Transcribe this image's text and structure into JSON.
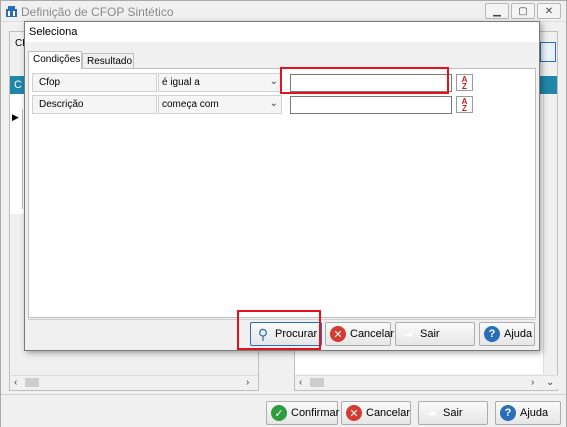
{
  "window": {
    "title": "Definição de CFOP Sintético",
    "bg_label_cf": "CF",
    "bg_label_c": "C"
  },
  "dialog": {
    "title": "Seleciona",
    "tabs": [
      {
        "label": "Condições",
        "active": true
      },
      {
        "label": "Resultado",
        "active": false
      }
    ],
    "conditions": [
      {
        "field": "Cfop",
        "operator": "é igual a",
        "value": ""
      },
      {
        "field": "Descrição",
        "operator": "começa com",
        "value": ""
      }
    ],
    "buttons": {
      "search": "Procurar",
      "cancel": "Cancelar",
      "exit": "Sair",
      "help": "Ajuda"
    }
  },
  "footer": {
    "confirm": "Confirmar",
    "cancel": "Cancelar",
    "exit": "Sair",
    "help": "Ajuda"
  },
  "icons": {
    "confirm": "check-icon",
    "cancel": "close-icon",
    "exit": "exit-door-icon",
    "help": "help-icon",
    "search": "magnifier-icon",
    "sort": "sort-az-icon"
  },
  "colors": {
    "highlight": "#e0141c",
    "accent_blue": "#1f86a8"
  }
}
